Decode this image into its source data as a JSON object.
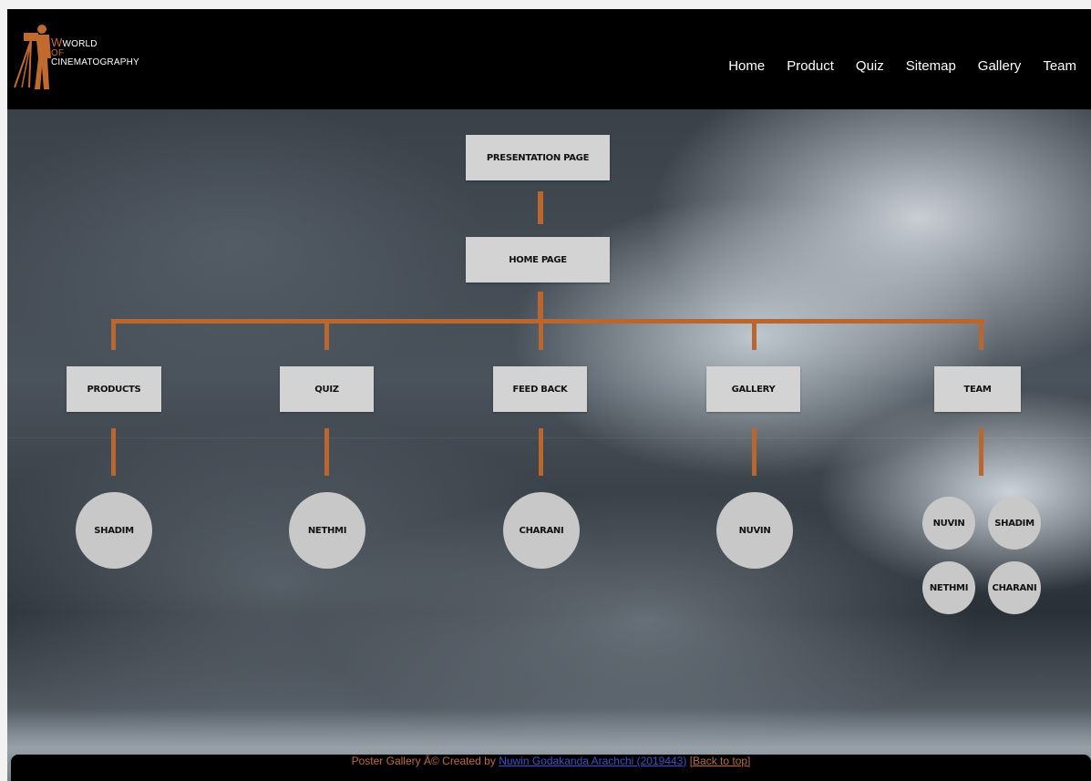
{
  "header": {
    "logo": {
      "line1": "WORLD",
      "line2": "OF",
      "line3": "CINEMATOGRAPHY"
    },
    "nav": [
      "Home",
      "Product",
      "Quiz",
      "Sitemap",
      "Gallery",
      "Team"
    ]
  },
  "sitemap": {
    "root": "Presentation Page",
    "home": "Home page",
    "sections": [
      "Products",
      "Quiz",
      "Feed Back",
      "Gallery",
      "Team"
    ],
    "owners": [
      "Shadim",
      "Nethmi",
      "Charani",
      "Nuvin"
    ],
    "team_members": [
      "Nuvin",
      "Shadim",
      "Nethmi",
      "Charani"
    ]
  },
  "footer": {
    "prefix": "Poster Gallery Â© Created by",
    "author_link": "Nuwin Godakanda Arachchi (2019443)",
    "back_to_top": "[Back to top]"
  },
  "colors": {
    "accent": "#b9662f",
    "node_bg": "#d3d3d3",
    "header_bg": "#000000"
  }
}
